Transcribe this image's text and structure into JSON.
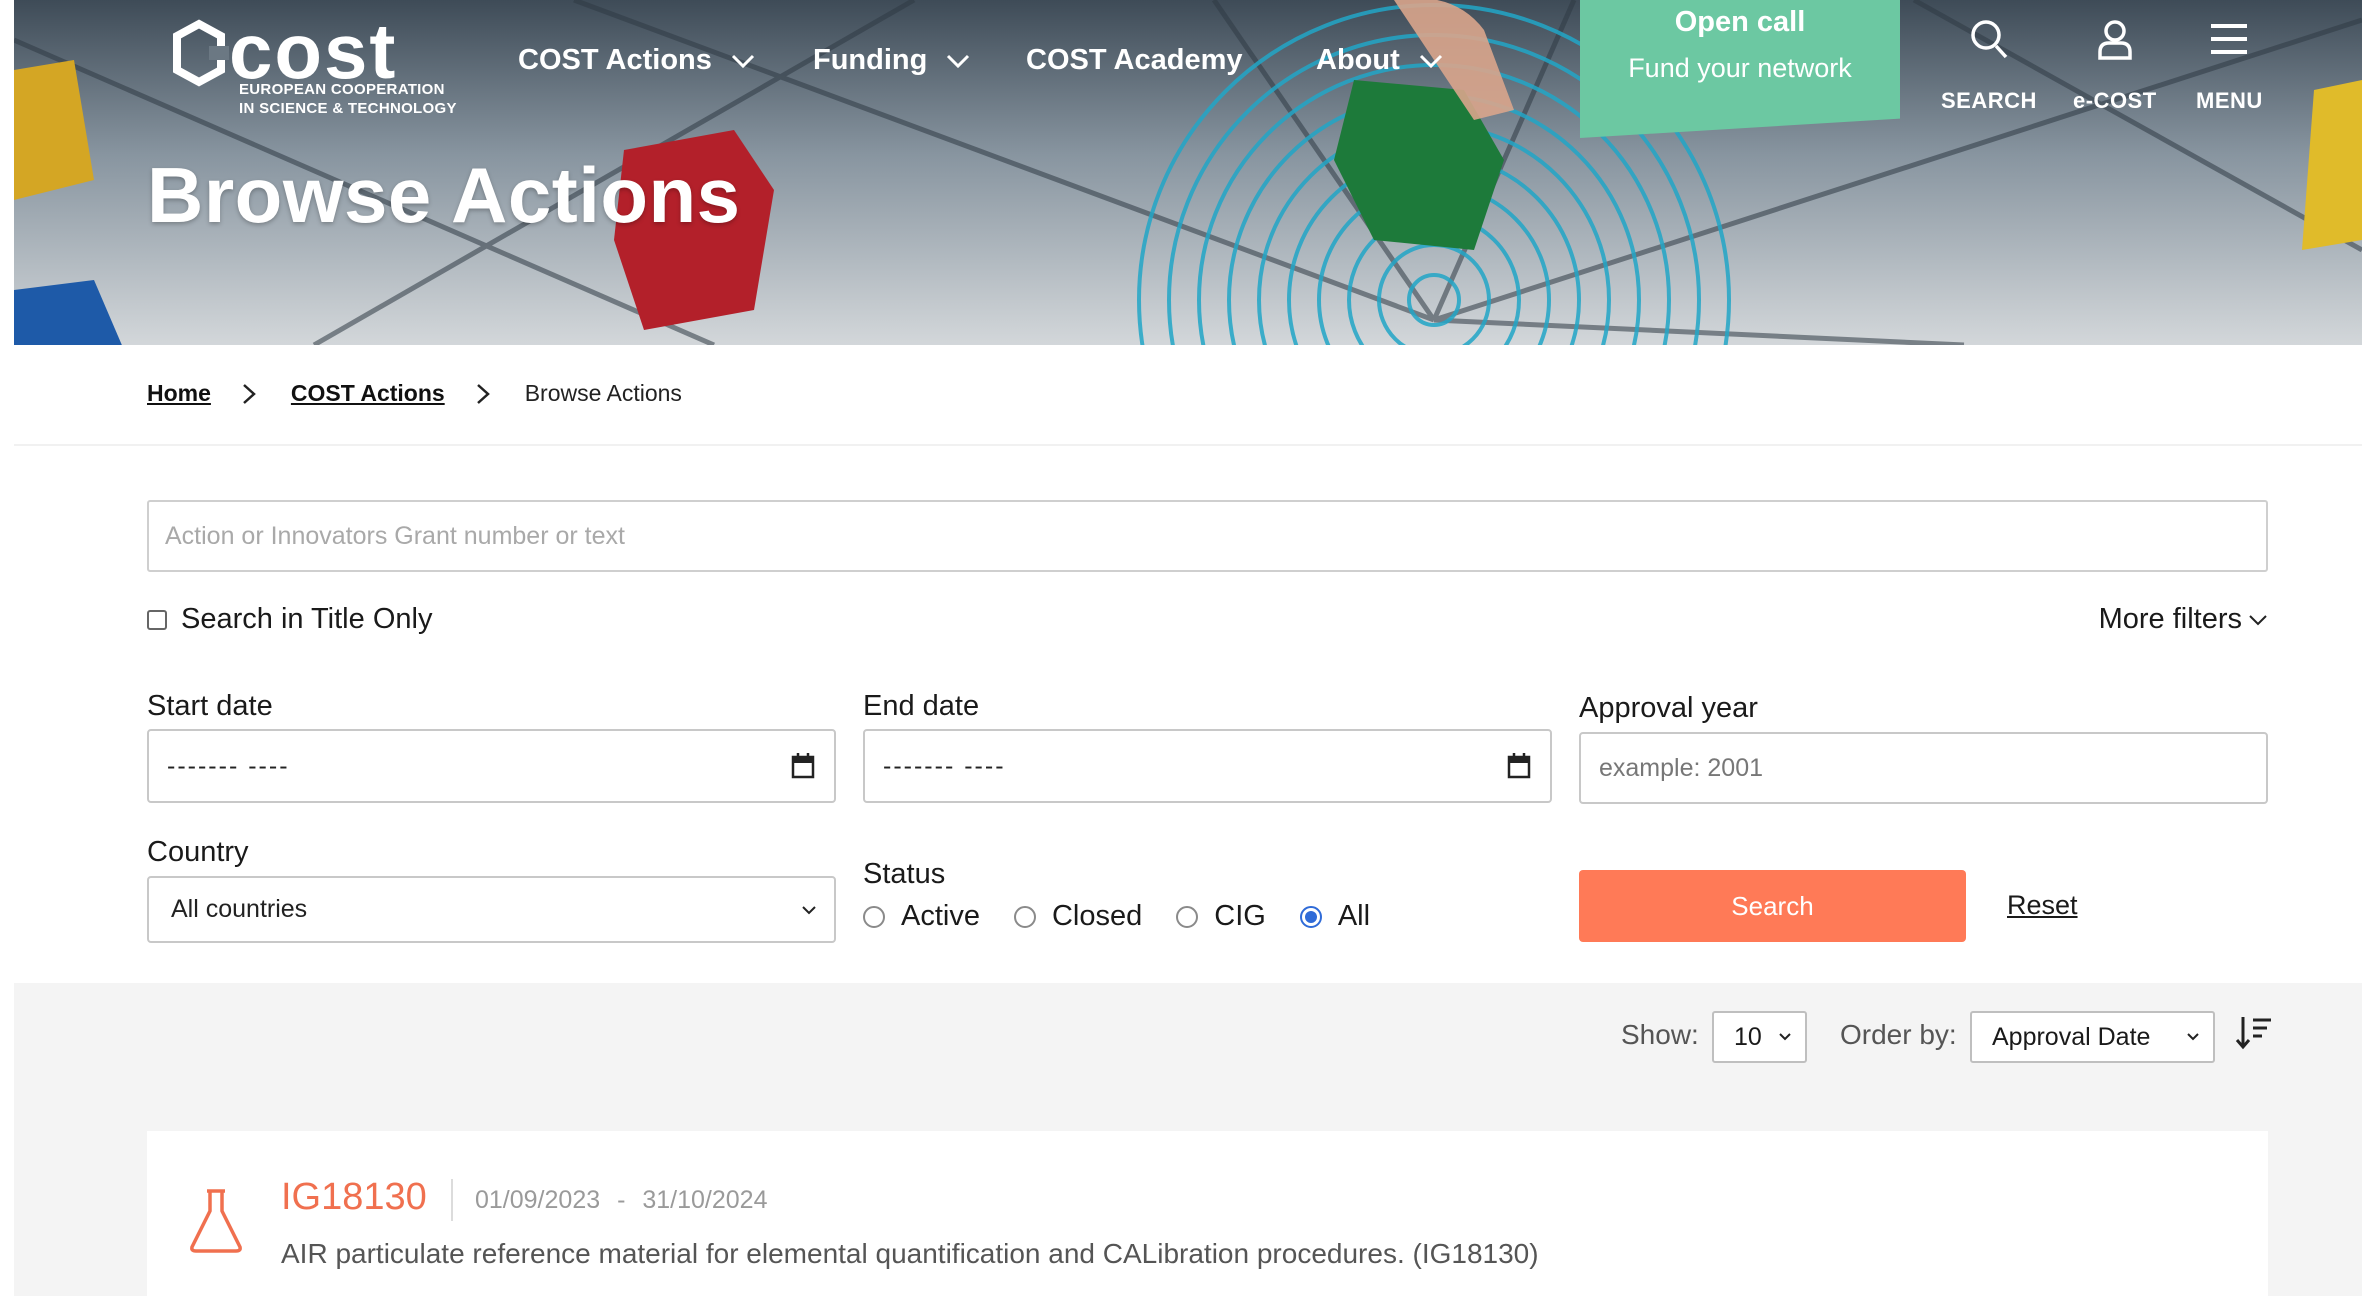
{
  "logo": {
    "wordmark": "cost",
    "subtitle": "EUROPEAN COOPERATION\nIN SCIENCE & TECHNOLOGY"
  },
  "nav": {
    "items": [
      {
        "label": "COST Actions",
        "has_dropdown": true
      },
      {
        "label": "Funding",
        "has_dropdown": true
      },
      {
        "label": "COST Academy",
        "has_dropdown": false
      },
      {
        "label": "About",
        "has_dropdown": true
      }
    ],
    "open_call": {
      "title": "Open call",
      "subtitle": "Fund your network"
    },
    "utilities": [
      {
        "label": "SEARCH",
        "icon": "search-icon"
      },
      {
        "label": "e-COST",
        "icon": "user-icon"
      },
      {
        "label": "MENU",
        "icon": "hamburger-icon"
      }
    ]
  },
  "hero": {
    "title": "Browse Actions"
  },
  "breadcrumb": {
    "home": "Home",
    "section": "COST Actions",
    "current": "Browse Actions"
  },
  "search": {
    "placeholder": "Action or Innovators Grant number or text",
    "value": "",
    "title_only_label": "Search in Title Only",
    "title_only_checked": false,
    "more_filters_label": "More filters"
  },
  "filters": {
    "start_date": {
      "label": "Start date",
      "value": "------- ----"
    },
    "end_date": {
      "label": "End date",
      "value": "------- ----"
    },
    "approval_year": {
      "label": "Approval year",
      "placeholder": "example: 2001"
    },
    "country": {
      "label": "Country",
      "selected": "All countries"
    },
    "status": {
      "label": "Status",
      "options": [
        "Active",
        "Closed",
        "CIG",
        "All"
      ],
      "selected": "All"
    },
    "search_button": "Search",
    "reset_link": "Reset"
  },
  "results": {
    "show_label": "Show:",
    "show_value": "10",
    "order_label": "Order by:",
    "order_value": "Approval Date",
    "items": [
      {
        "code": "IG18130",
        "start": "01/09/2023",
        "end": "31/10/2024",
        "date_separator": "-",
        "title": "AIR particulate reference material for elemental quantification and CALibration procedures. (IG18130)",
        "icon": "flask-icon"
      }
    ]
  },
  "colors": {
    "accent_orange": "#ff7a57",
    "open_call_green": "#6cc8a2",
    "code_orange": "#f0704f",
    "radio_blue": "#2f6bd8"
  }
}
